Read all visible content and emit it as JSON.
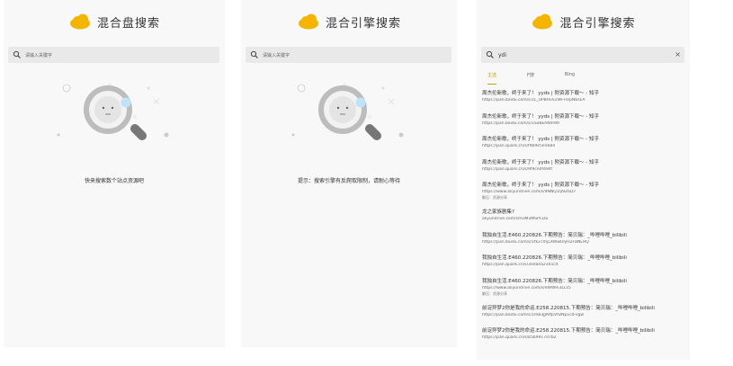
{
  "panels": [
    {
      "title": "混合盘搜索",
      "search_placeholder": "请输入关键字",
      "hint": "快来搜索数个站点资源吧"
    },
    {
      "title": "混合引擎搜索",
      "search_placeholder": "请输入关键字",
      "hint": "提示：搜索引擎有反爬取限制，请耐心等待"
    },
    {
      "title": "混合引擎搜索",
      "search_value": "ydi",
      "clear_icon": "×",
      "tabs": [
        "主选",
        "F搜",
        "Bing"
      ],
      "results": [
        {
          "title": "周杰伦新歌，终于来了！ yyds | 附资源下载～ - 知乎",
          "url": "https://pan.baidu.com/s/1L_UPBHvS1WFFiVpNbsEA"
        },
        {
          "title": "周杰伦新歌，终于来了！ yyds | 附资源下载～ - 知乎",
          "url": "https://pan.baidu.com/s/1SaBEhNm9tl"
        },
        {
          "title": "周杰伦新歌，终于来了！ yyds | 附资源下载～ - 知乎",
          "url": "https://pan.quark.cn/s/f9b9e5e5684"
        },
        {
          "title": "周杰伦新歌，终于来了！ yyds | 附资源下载～ - 知乎",
          "url": "https://pan.quark.cn/s/9f9ce0f494f"
        },
        {
          "title": "周杰伦新歌，终于来了！ yyds | 附资源下载～ - 知乎",
          "url": "https://www.aliyundrive.com/s/9NNQ1Q9Z6D7",
          "size": "解压：资源分享"
        },
        {
          "title": "龙之家族剧集?",
          "url": "aliyundrive.com/s/H3M3MSPCDu"
        },
        {
          "title": "我独自生活.E460.220826.下期预告：简贝瑞：_哔哩哔哩_bilibili",
          "url": "https://pan.baidu.com/s/1fk2TmjLXWwUlyH2F8NLHQ"
        },
        {
          "title": "我独自生活.E460.220826.下期预告：简贝瑞：_哔哩哔哩_bilibili",
          "url": "https://pan.quark.cn/s/3edaea2301c4"
        },
        {
          "title": "我独自生活.E460.220826.下期预告：简贝瑞：_哔哩哔哩_bilibili",
          "url": "https://www.aliyundrive.com/s/eWWRi3LLs5",
          "size": "解压：资源分享"
        },
        {
          "title": "前淀异梦2你是我的命运.E258.220815.下期预告：简贝瑞：_哔哩哔哩_bilibili",
          "url": "https://pan.baidu.com/s/1mB3JJAtfpVfDNp1cd-sgw"
        },
        {
          "title": "前淀异梦2你是我的命运.E258.220815.下期预告：简贝瑞：_哔哩哔哩_bilibili",
          "url": "https://pan.quark.cn/s/b5b9917d7b2"
        }
      ]
    }
  ],
  "colors": {
    "accent": "#c8a000",
    "cloud": "#f4b400",
    "panel_bg": "#f8f8f8",
    "search_bg": "#e9e9e9"
  }
}
